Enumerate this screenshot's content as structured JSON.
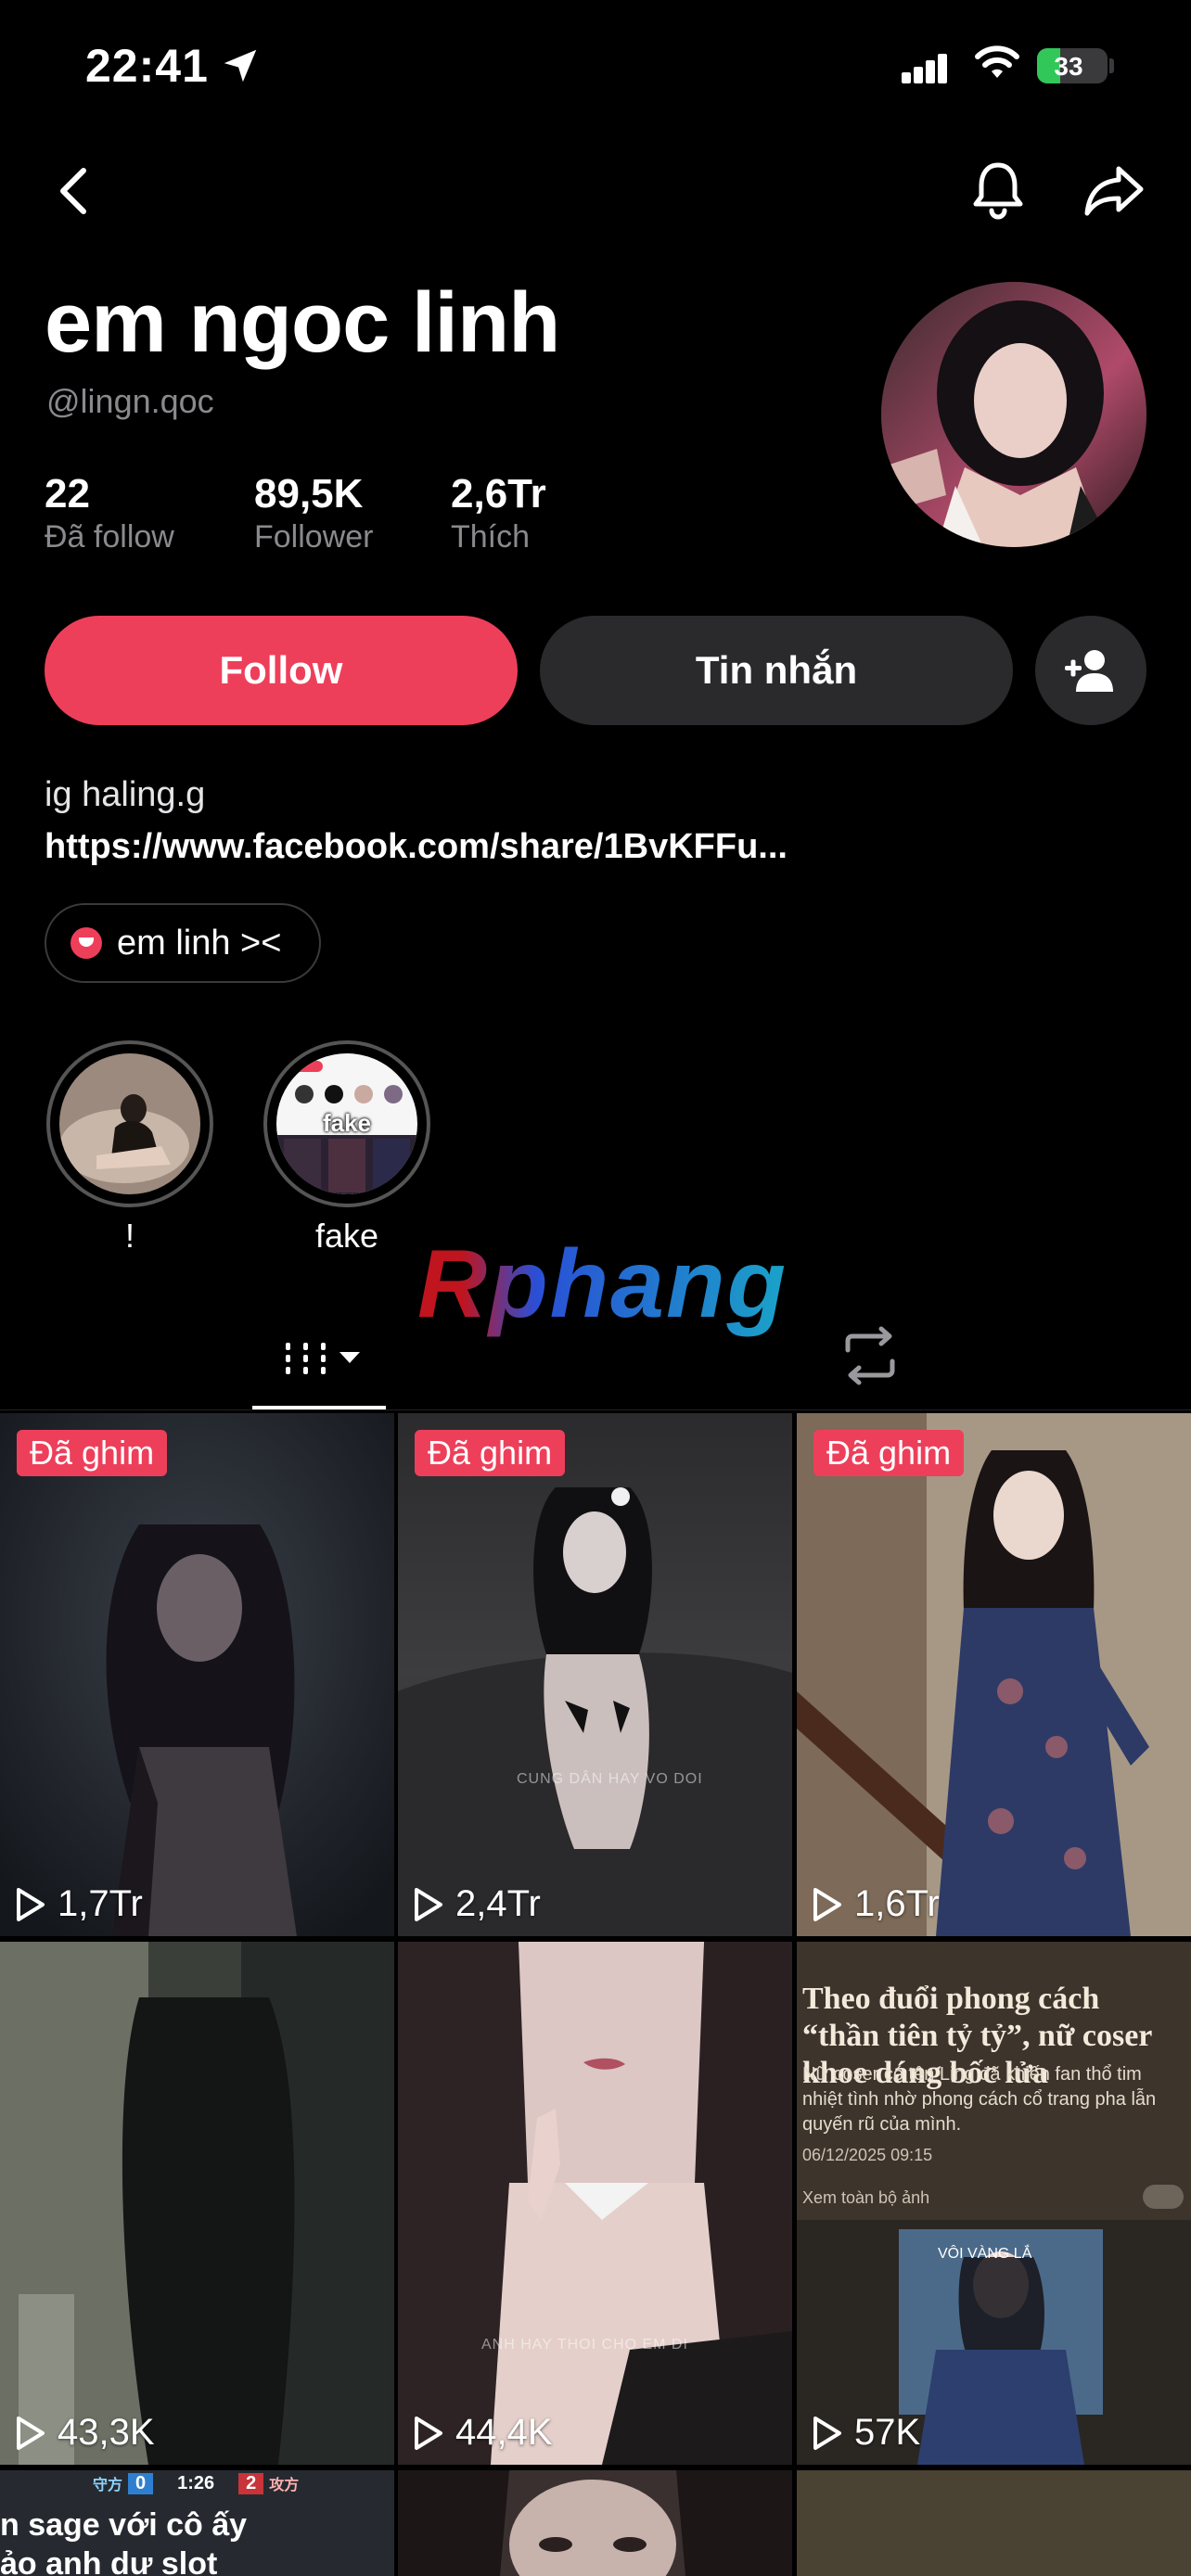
{
  "status_bar": {
    "time": "22:41",
    "battery": "33"
  },
  "profile": {
    "name": "em ngoc linh",
    "handle": "@lingn.qoc",
    "stats": [
      {
        "value": "22",
        "label": "Đã follow"
      },
      {
        "value": "89,5K",
        "label": "Follower"
      },
      {
        "value": "2,6Tr",
        "label": "Thích"
      }
    ],
    "follow_label": "Follow",
    "message_label": "Tin nhắn",
    "bio_line1": "ig haling.g",
    "bio_link": "https://www.facebook.com/share/1BvKFFu...",
    "chip_label": "em linh ><"
  },
  "highlights": [
    {
      "label": "!"
    },
    {
      "label": "fake",
      "overlay": "fake"
    }
  ],
  "watermark": "Rphang",
  "colors": {
    "accent": "#ee3f5a",
    "secondary_button": "#2a2a2c",
    "background": "#000000"
  },
  "videos": [
    {
      "pinned_label": "Đã ghim",
      "views": "1,7Tr"
    },
    {
      "pinned_label": "Đã ghim",
      "views": "2,4Tr",
      "caption": "CUNG DÂN HAY VO DOI"
    },
    {
      "pinned_label": "Đã ghim",
      "views": "1,6Tr"
    },
    {
      "views": "43,3K"
    },
    {
      "views": "44,4K",
      "caption": "ANH HAY THOI CHO EM DI"
    },
    {
      "views": "57K",
      "news_title": "Theo đuổi phong cách “thần tiên tỷ tỷ”, nữ coser khoe dáng bốc lửa",
      "news_body": "Nữ coser có tên Ling đã khiến fan thổ tim nhiệt tình nhờ phong cách cổ trang pha lẫn quyến rũ của mình.",
      "news_date": "06/12/2025 09:15",
      "news_option": "Xem toàn bộ ảnh",
      "news_caption": "VÔI VÀNG LẮ"
    },
    {
      "hud": {
        "left_label": "守方",
        "left_score": "0",
        "timer": "1:26",
        "right_score": "2",
        "right_label": "攻方"
      },
      "text_line1": "n sage với cô ấy",
      "text_line2": "ảo anh dự slot"
    },
    {},
    {}
  ],
  "icons": [
    "location-arrow-icon",
    "signal-icon",
    "wifi-icon",
    "battery-icon",
    "back-icon",
    "bell-icon",
    "share-icon",
    "add-friend-icon",
    "grid-icon",
    "repost-icon",
    "play-icon"
  ]
}
